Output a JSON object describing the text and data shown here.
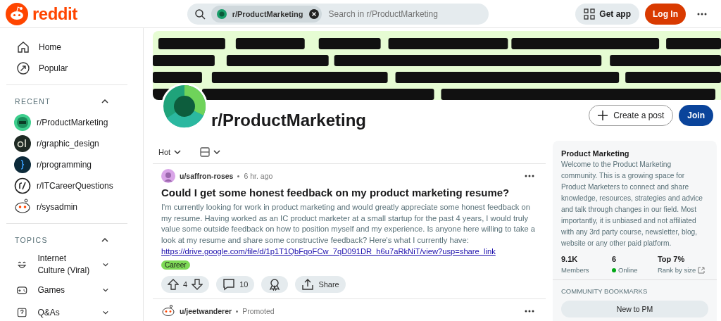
{
  "header": {
    "logo": "reddit",
    "search": {
      "chip": "r/ProductMarketing",
      "placeholder": "Search in r/ProductMarketing"
    },
    "get_app": "Get app",
    "login": "Log In"
  },
  "sidebar": {
    "nav": [
      {
        "label": "Home",
        "selected": false
      },
      {
        "label": "Popular",
        "selected": false
      }
    ],
    "sections": [
      {
        "title": "RECENT",
        "expanded": true,
        "items": [
          {
            "label": "r/ProductMarketing"
          },
          {
            "label": "r/graphic_design"
          },
          {
            "label": "r/programming"
          },
          {
            "label": "r/ITCareerQuestions"
          },
          {
            "label": "r/sysadmin"
          }
        ]
      },
      {
        "title": "TOPICS",
        "expanded": true,
        "items": [
          {
            "label": "Internet Culture (Viral)",
            "expanded": false
          },
          {
            "label": "Games",
            "expanded": false
          },
          {
            "label": "Q&As",
            "expanded": false
          }
        ]
      }
    ]
  },
  "community": {
    "name": "r/ProductMarketing",
    "create_post": "Create a post",
    "join": "Join"
  },
  "feed": {
    "sort": "Hot",
    "posts": [
      {
        "author": "u/saffron-roses",
        "time": "6 hr. ago",
        "title": "Could I get some honest feedback on my product marketing resume?",
        "body": "I'm currently looking for work in product marketing and would greatly appreciate some honest feedback on my resume. Having worked as an IC product marketer at a small startup for the past 4 years, I would truly value some outside feedback on how to position myself and my experience. Is anyone here willing to take a look at my resume and share some constructive feedback? Here's what I currently have:",
        "link": "https://drive.google.com/file/d/1p1T1QbFqoFCw_7qD091DR_h6u7aRkNiT/view?usp=share_link",
        "flair": "Career",
        "votes": "4",
        "comments": "10",
        "share": "Share"
      },
      {
        "author": "u/jeetwanderer",
        "time": "Promoted"
      }
    ]
  },
  "about": {
    "title": "Product Marketing",
    "description": "Welcome to the Product Marketing community. This is a growing space for Product Marketers to connect and share knowledge, resources, strategies and advice and talk through changes in our field. Most importantly, it is unbiased and not affiliated with any 3rd party course, newsletter, blog, website or any other paid platform.",
    "stats": [
      {
        "kind": "plain",
        "value": "9.1K",
        "label": "Members"
      },
      {
        "kind": "online",
        "value": "6",
        "label": "Online"
      },
      {
        "kind": "rank",
        "value": "Top 7%",
        "label": "Rank by size"
      }
    ],
    "bookmarks_title": "COMMUNITY BOOKMARKS",
    "bookmarks": [
      "New to PM"
    ]
  }
}
